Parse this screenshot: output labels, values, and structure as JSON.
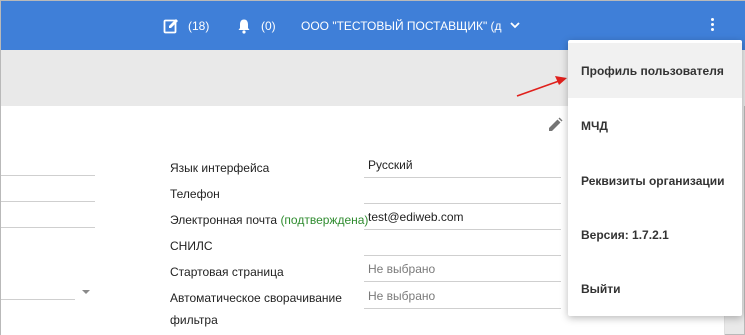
{
  "topbar": {
    "drafts_count": "(18)",
    "notifications_count": "(0)",
    "org_name": "ООО \"ТЕСТОВЫЙ ПОСТАВЩИК\" (д",
    "accent_color": "#3f7fd8",
    "icons": [
      "edit-document-icon",
      "bell-icon",
      "chevron-down-icon",
      "more-vertical-icon"
    ]
  },
  "profile": {
    "fields": [
      {
        "label": "Язык интерфейса",
        "value": "Русский",
        "placeholder": false
      },
      {
        "label": "Телефон",
        "value": "",
        "placeholder": false
      },
      {
        "label": "Электронная почта",
        "label_status": "(подтверждена)",
        "value": "test@ediweb.com",
        "placeholder": false
      },
      {
        "label": "СНИЛС",
        "value": "",
        "placeholder": false
      },
      {
        "label": "Стартовая страница",
        "value": "Не выбрано",
        "placeholder": true
      },
      {
        "label": "Автоматическое сворачивание",
        "label_line2": "фильтра",
        "value": "Не выбрано",
        "placeholder": true
      }
    ]
  },
  "menu": {
    "items": [
      {
        "label": "Профиль пользователя"
      },
      {
        "label": "МЧД"
      },
      {
        "label": "Реквизиты организации"
      },
      {
        "label": "Версия: 1.7.2.1"
      },
      {
        "label": "Выйти"
      }
    ]
  }
}
